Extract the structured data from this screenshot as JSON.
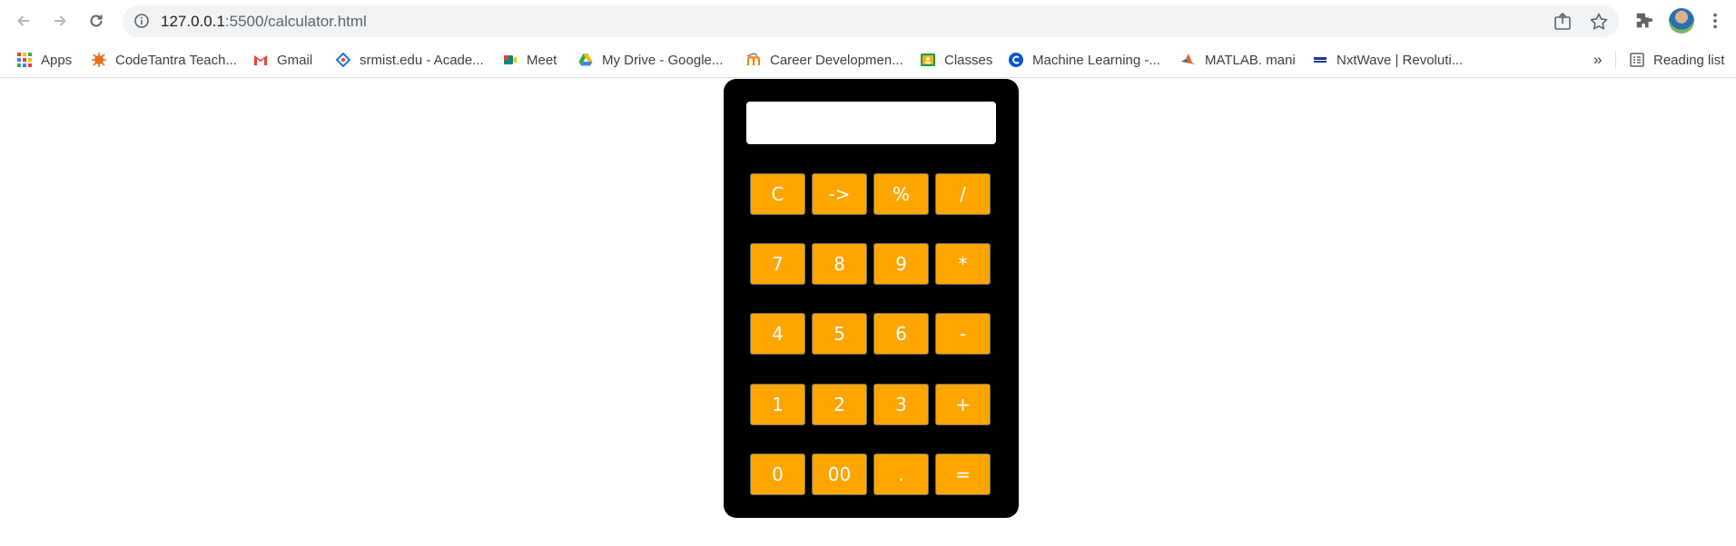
{
  "browser": {
    "url_host": "127.0.0.1",
    "url_path": ":5500/calculator.html",
    "reading_list_label": "Reading list",
    "more_bookmarks": "»"
  },
  "bookmarks": [
    {
      "label": "Apps",
      "icon": "apps-grid-icon"
    },
    {
      "label": "CodeTantra Teach...",
      "icon": "codetantra-icon",
      "color": "#e8711a"
    },
    {
      "label": "Gmail",
      "icon": "gmail-icon",
      "color": "#ea4335"
    },
    {
      "label": "srmist.edu - Acade...",
      "icon": "srmist-icon",
      "color": "#1a73e8"
    },
    {
      "label": "Meet",
      "icon": "meet-icon",
      "color": "#00897b"
    },
    {
      "label": "My Drive - Google...",
      "icon": "drive-icon",
      "color": "#fbbc04"
    },
    {
      "label": "Career Developmen...",
      "icon": "moodle-icon",
      "color": "#f98012"
    },
    {
      "label": "Classes",
      "icon": "classroom-icon",
      "color": "#0f9d58"
    },
    {
      "label": "Machine Learning -...",
      "icon": "coursera-icon",
      "color": "#0056d2"
    },
    {
      "label": "MATLAB. mani",
      "icon": "matlab-icon",
      "color": "#e16737"
    },
    {
      "label": "NxtWave | Revoluti...",
      "icon": "nxtwave-icon",
      "color": "#1e3a8a"
    }
  ],
  "calculator": {
    "display_value": "",
    "keys": [
      "C",
      "->",
      "%",
      "/",
      "7",
      "8",
      "9",
      "*",
      "4",
      "5",
      "6",
      "-",
      "1",
      "2",
      "3",
      "+",
      "0",
      "00",
      ".",
      "="
    ],
    "key_color": "#ffa500",
    "body_color": "#000000"
  }
}
